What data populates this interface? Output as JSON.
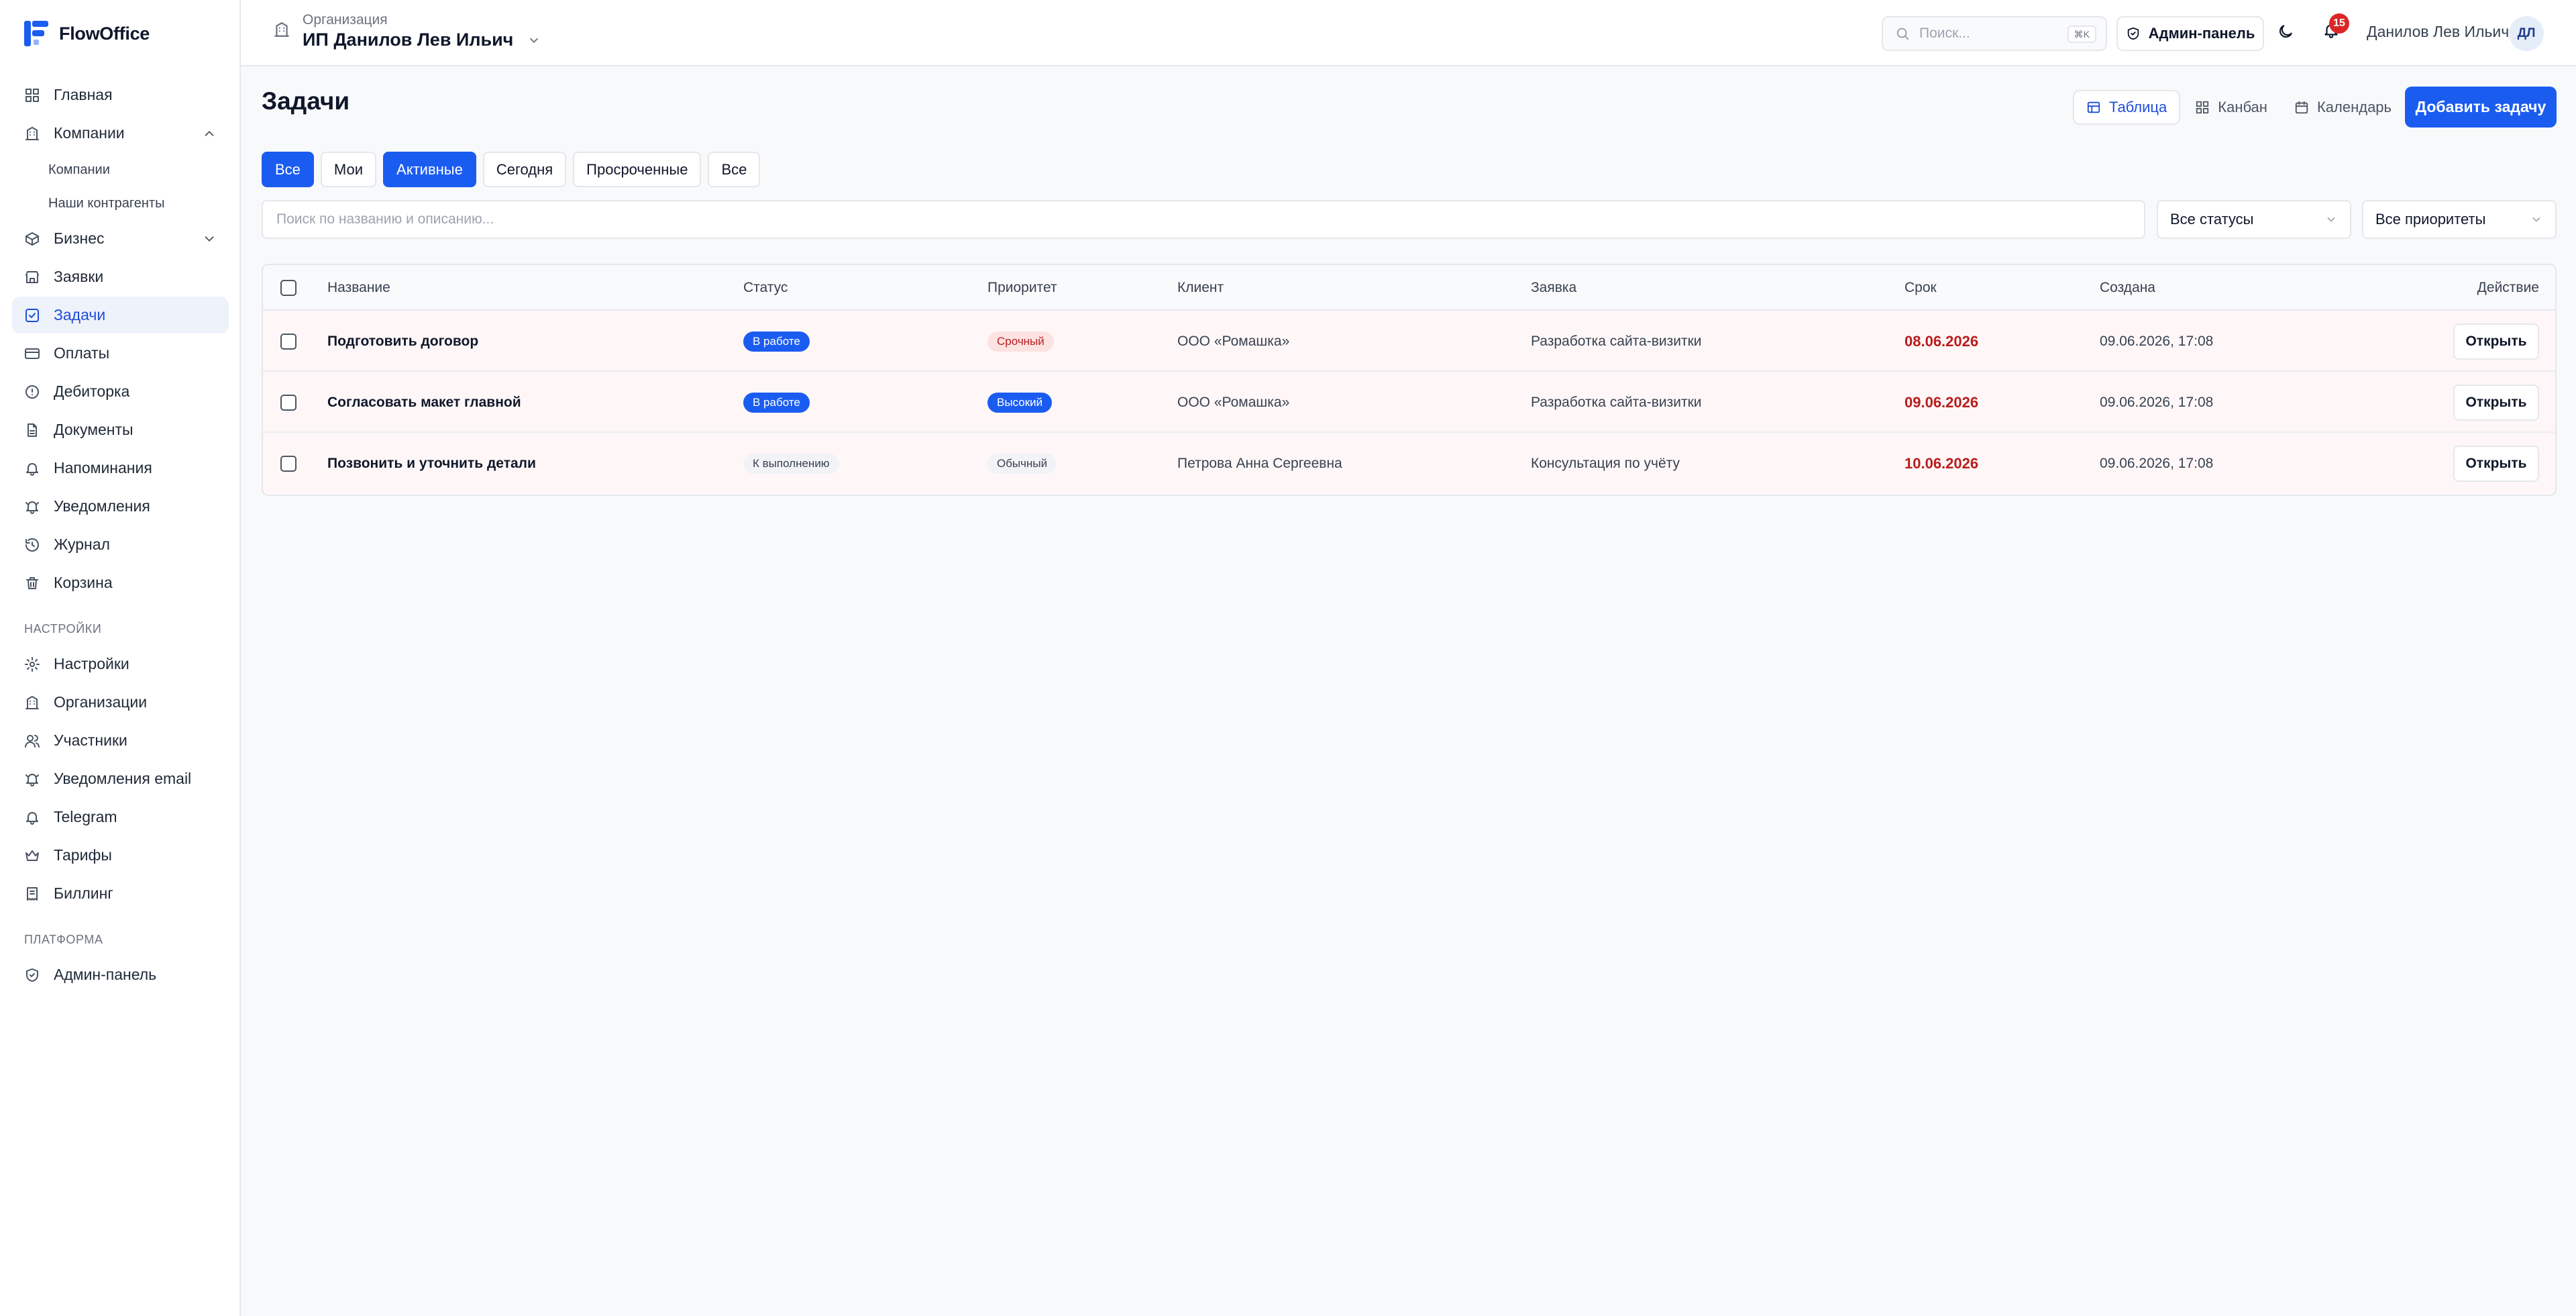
{
  "app": {
    "name": "FlowOffice"
  },
  "sidebar": {
    "items": [
      {
        "label": "Главная"
      },
      {
        "label": "Компании"
      },
      {
        "label": "Компании"
      },
      {
        "label": "Наши контрагенты"
      },
      {
        "label": "Бизнес"
      },
      {
        "label": "Заявки"
      },
      {
        "label": "Задачи"
      },
      {
        "label": "Оплаты"
      },
      {
        "label": "Дебиторка"
      },
      {
        "label": "Документы"
      },
      {
        "label": "Напоминания"
      },
      {
        "label": "Уведомления"
      },
      {
        "label": "Журнал"
      },
      {
        "label": "Корзина"
      }
    ],
    "settings_section": "НАСТРОЙКИ",
    "settings_items": [
      {
        "label": "Настройки"
      },
      {
        "label": "Организации"
      },
      {
        "label": "Участники"
      },
      {
        "label": "Уведомления email"
      },
      {
        "label": "Telegram"
      },
      {
        "label": "Тарифы"
      },
      {
        "label": "Биллинг"
      }
    ],
    "platform_section": "ПЛАТФОРМА",
    "platform_items": [
      {
        "label": "Админ-панель"
      }
    ]
  },
  "topbar": {
    "org_label": "Организация",
    "org_name": "ИП Данилов Лев Ильич",
    "search_placeholder": "Поиск...",
    "search_shortcut": "⌘K",
    "admin_label": "Админ-панель",
    "notifications_count": "15",
    "user_name": "Данилов Лев Ильич",
    "user_initials": "ДЛ"
  },
  "main": {
    "title": "Задачи",
    "views": [
      {
        "label": "Таблица"
      },
      {
        "label": "Канбан"
      },
      {
        "label": "Календарь"
      }
    ],
    "add_button": "Добавить задачу",
    "filters": [
      {
        "label": "Все"
      },
      {
        "label": "Мои"
      },
      {
        "label": "Активные"
      },
      {
        "label": "Сегодня"
      },
      {
        "label": "Просроченные"
      },
      {
        "label": "Все"
      }
    ],
    "search_placeholder": "Поиск по названию и описанию...",
    "status_select": "Все статусы",
    "priority_select": "Все приоритеты"
  },
  "table": {
    "headers": {
      "name": "Название",
      "status": "Статус",
      "priority": "Приоритет",
      "client": "Клиент",
      "request": "Заявка",
      "due": "Срок",
      "created": "Создана",
      "action": "Действие"
    },
    "rows": [
      {
        "name": "Подготовить договор",
        "status": "В работе",
        "priority": "Срочный",
        "client": "ООО «Ромашка»",
        "request": "Разработка сайта-визитки",
        "due": "08.06.2026",
        "created": "09.06.2026, 17:08",
        "action": "Открыть"
      },
      {
        "name": "Согласовать макет главной",
        "status": "В работе",
        "priority": "Высокий",
        "client": "ООО «Ромашка»",
        "request": "Разработка сайта-визитки",
        "due": "09.06.2026",
        "created": "09.06.2026, 17:08",
        "action": "Открыть"
      },
      {
        "name": "Позвонить и уточнить детали",
        "status": "К выполнению",
        "priority": "Обычный",
        "client": "Петрова Анна Сергеевна",
        "request": "Консультация по учёту",
        "due": "10.06.2026",
        "created": "09.06.2026, 17:08",
        "action": "Открыть"
      }
    ]
  },
  "colors": {
    "accent": "#1b5cf0",
    "danger": "#b91c1c",
    "badge_red_bg": "#fde2e2"
  }
}
